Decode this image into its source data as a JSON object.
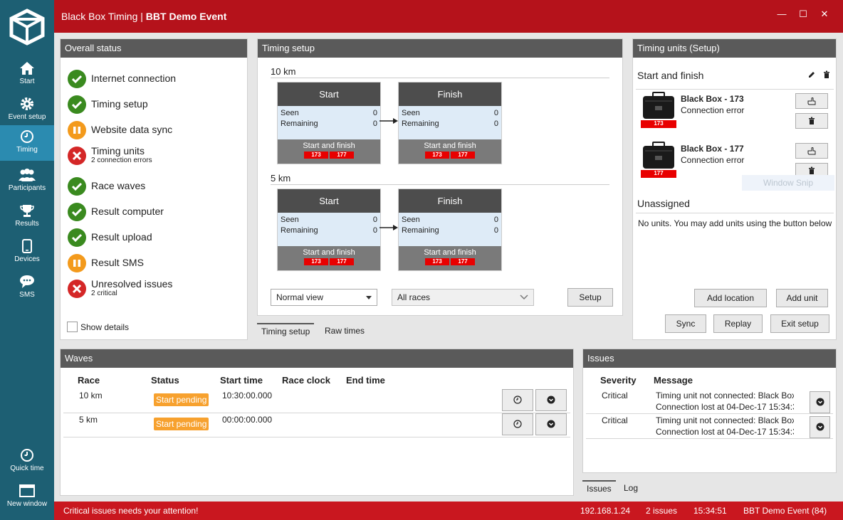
{
  "window": {
    "title_app": "Black Box Timing | ",
    "title_event": "BBT Demo Event",
    "controls": {
      "minimize": "—",
      "maximize": "☐",
      "close": "✕"
    }
  },
  "sidebar": {
    "items": [
      {
        "label": "Start",
        "icon": "home-icon"
      },
      {
        "label": "Event setup",
        "icon": "gear-icon"
      },
      {
        "label": "Timing",
        "icon": "clock-icon",
        "active": true
      },
      {
        "label": "Participants",
        "icon": "people-icon"
      },
      {
        "label": "Results",
        "icon": "trophy-icon"
      },
      {
        "label": "Devices",
        "icon": "tablet-icon"
      },
      {
        "label": "SMS",
        "icon": "chat-icon"
      }
    ],
    "bottom": [
      {
        "label": "Quick time",
        "icon": "clock-icon"
      },
      {
        "label": "New window",
        "icon": "window-icon"
      }
    ]
  },
  "overall_status": {
    "header": "Overall status",
    "items": [
      {
        "label": "Internet connection",
        "sub": "",
        "state": "ok"
      },
      {
        "label": "Timing setup",
        "sub": "",
        "state": "ok"
      },
      {
        "label": "Website data sync",
        "sub": "",
        "state": "paused"
      },
      {
        "label": "Timing units",
        "sub": "2 connection errors",
        "state": "error"
      },
      {
        "label": "Race waves",
        "sub": "",
        "state": "ok"
      },
      {
        "label": "Result computer",
        "sub": "",
        "state": "ok"
      },
      {
        "label": "Result upload",
        "sub": "",
        "state": "ok"
      },
      {
        "label": "Result SMS",
        "sub": "",
        "state": "paused"
      },
      {
        "label": "Unresolved issues",
        "sub": "2 critical",
        "state": "error"
      }
    ],
    "show_details": "Show details",
    "colors": {
      "ok": "#3a8a1f",
      "paused": "#f39a1c",
      "error": "#d42727"
    }
  },
  "timing_setup": {
    "header": "Timing setup",
    "races": [
      {
        "name": "10 km",
        "boxes": [
          {
            "title": "Start",
            "seen_label": "Seen",
            "seen": "0",
            "remaining_label": "Remaining",
            "remaining": "0",
            "location": "Start and finish",
            "tags": [
              "173",
              "177"
            ]
          },
          {
            "title": "Finish",
            "seen_label": "Seen",
            "seen": "0",
            "remaining_label": "Remaining",
            "remaining": "0",
            "location": "Start and finish",
            "tags": [
              "173",
              "177"
            ]
          }
        ]
      },
      {
        "name": "5 km",
        "boxes": [
          {
            "title": "Start",
            "seen_label": "Seen",
            "seen": "0",
            "remaining_label": "Remaining",
            "remaining": "0",
            "location": "Start and finish",
            "tags": [
              "173",
              "177"
            ]
          },
          {
            "title": "Finish",
            "seen_label": "Seen",
            "seen": "0",
            "remaining_label": "Remaining",
            "remaining": "0",
            "location": "Start and finish",
            "tags": [
              "173",
              "177"
            ]
          }
        ]
      }
    ],
    "view_select": "Normal view",
    "race_select": "All races",
    "setup_button": "Setup",
    "tabs": [
      "Timing setup",
      "Raw times"
    ]
  },
  "timing_units": {
    "header": "Timing units (Setup)",
    "location": "Start and finish",
    "units": [
      {
        "name": "Black Box - 173",
        "status": "Connection error",
        "tag": "173"
      },
      {
        "name": "Black Box - 177",
        "status": "Connection error",
        "tag": "177"
      }
    ],
    "unassigned_title": "Unassigned",
    "unassigned_text": "No units. You may add units using the button below",
    "buttons": {
      "add_location": "Add location",
      "add_unit": "Add unit",
      "sync": "Sync",
      "replay": "Replay",
      "exit_setup": "Exit setup"
    },
    "snip_label": "Window Snip"
  },
  "waves": {
    "header": "Waves",
    "columns": [
      "Race",
      "Status",
      "Start time",
      "Race clock",
      "End time"
    ],
    "rows": [
      {
        "race": "10 km",
        "status": "Start pending",
        "start_time": "10:30:00.000",
        "race_clock": "",
        "end_time": ""
      },
      {
        "race": "5 km",
        "status": "Start pending",
        "start_time": "00:00:00.000",
        "race_clock": "",
        "end_time": ""
      }
    ]
  },
  "issues": {
    "header": "Issues",
    "columns": [
      "Severity",
      "Message"
    ],
    "rows": [
      {
        "severity": "Critical",
        "message_line1": "Timing unit not connected: Black Box",
        "message_line2": "Connection lost at 04-Dec-17 15:34:3"
      },
      {
        "severity": "Critical",
        "message_line1": "Timing unit not connected: Black Box",
        "message_line2": "Connection lost at 04-Dec-17 15:34:3"
      }
    ],
    "tabs": [
      "Issues",
      "Log"
    ]
  },
  "statusbar": {
    "message": "Critical issues needs your attention!",
    "ip": "192.168.1.24",
    "issues": "2 issues",
    "time": "15:34:51",
    "event": "BBT Demo Event (84)"
  }
}
